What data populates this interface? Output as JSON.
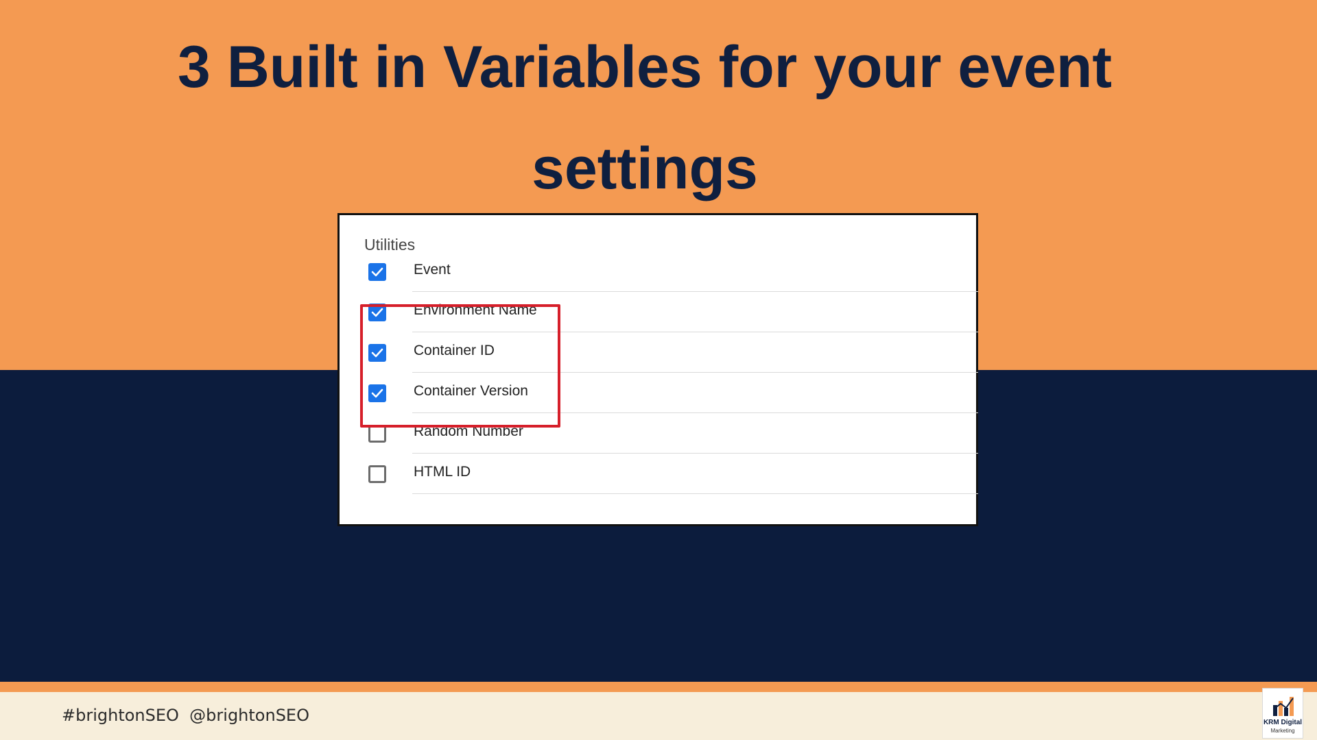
{
  "slide": {
    "title": "3 Built in Variables for your event settings"
  },
  "panel": {
    "heading": "Utilities",
    "items": [
      {
        "label": "Event",
        "checked": true
      },
      {
        "label": "Environment Name",
        "checked": true
      },
      {
        "label": "Container ID",
        "checked": true
      },
      {
        "label": "Container Version",
        "checked": true
      },
      {
        "label": "Random Number",
        "checked": false
      },
      {
        "label": "HTML ID",
        "checked": false
      }
    ]
  },
  "footer": {
    "text": "#brightonSEO  @brightonSEO"
  },
  "logo": {
    "name": "KRM Digital",
    "tagline": "Marketing"
  },
  "colors": {
    "orange": "#f49a52",
    "navy": "#0c1c3d",
    "checkbox_blue": "#1a73e8",
    "highlight_red": "#d61f2a"
  }
}
